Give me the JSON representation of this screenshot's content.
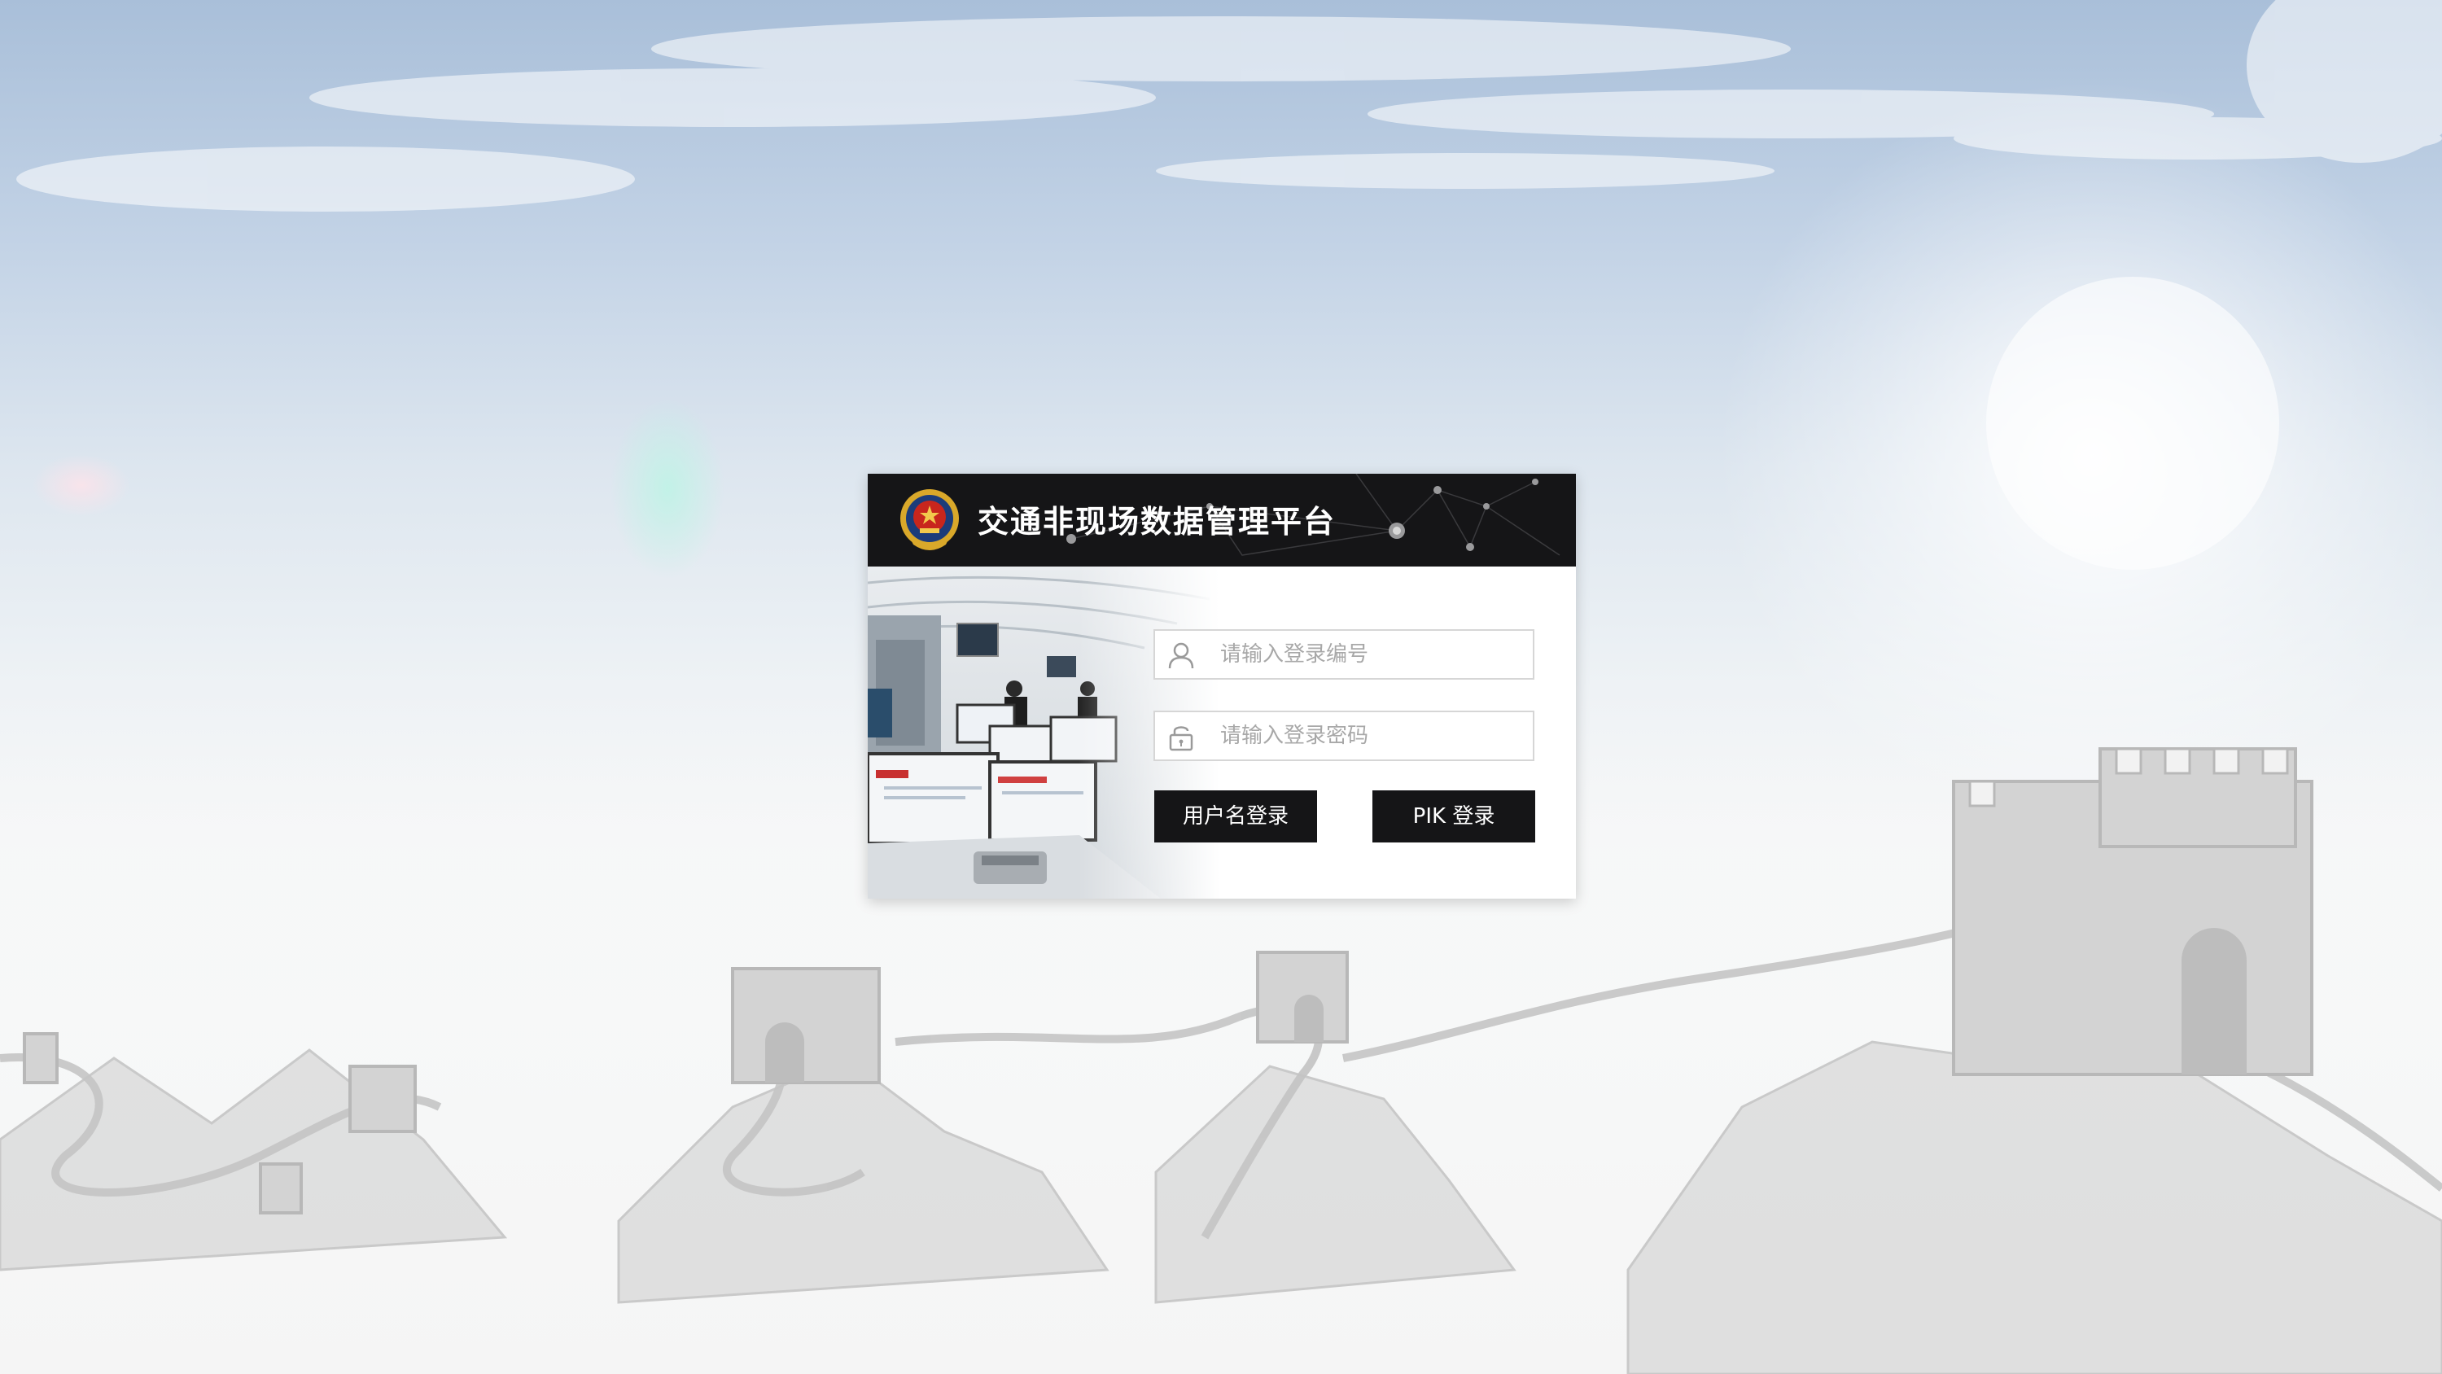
{
  "app": {
    "title": "交通非现场数据管理平台"
  },
  "login": {
    "username_placeholder": "请输入登录编号",
    "username_value": "",
    "password_placeholder": "请输入登录密码",
    "password_value": "",
    "username_login_label": "用户名登录",
    "pik_login_label": "PIK 登录"
  },
  "icons": {
    "emblem": "police-emblem-icon",
    "user": "user-icon",
    "lock": "lock-icon"
  },
  "colors": {
    "header_bg": "#151517",
    "button_bg": "#151517",
    "button_text": "#ffffff",
    "emblem_gold": "#d9a82a",
    "emblem_red": "#c8261d"
  }
}
